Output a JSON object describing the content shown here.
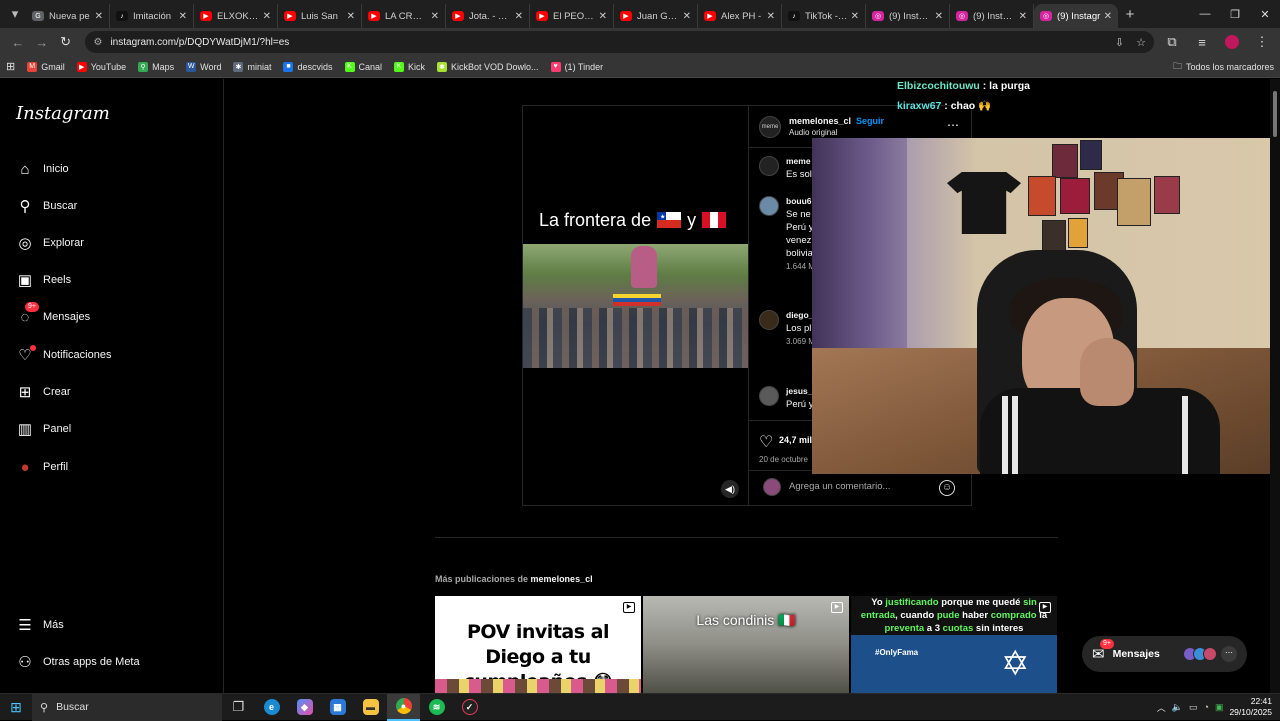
{
  "browser": {
    "tabs": [
      {
        "label": "Nueva pe",
        "fav_color": "#5f6368",
        "fav_glyph": "G"
      },
      {
        "label": "Imitación",
        "fav_color": "#111111",
        "fav_glyph": "♪"
      },
      {
        "label": "ELXOKAS",
        "fav_color": "#ff0000",
        "fav_glyph": "▶"
      },
      {
        "label": "Luis San",
        "fav_color": "#ff0000",
        "fav_glyph": "▶"
      },
      {
        "label": "LA CRONO",
        "fav_color": "#ff0000",
        "fav_glyph": "▶"
      },
      {
        "label": "Jota. - You",
        "fav_color": "#ff0000",
        "fav_glyph": "▶"
      },
      {
        "label": "El PEOR C",
        "fav_color": "#ff0000",
        "fav_glyph": "▶"
      },
      {
        "label": "Juan Gabri",
        "fav_color": "#ff0000",
        "fav_glyph": "▶"
      },
      {
        "label": "Alex PH -",
        "fav_color": "#ff0000",
        "fav_glyph": "▶"
      },
      {
        "label": "TikTok - M",
        "fav_color": "#111111",
        "fav_glyph": "♪"
      },
      {
        "label": "(9) Instagr",
        "fav_color": "#d6249f",
        "fav_glyph": "◎"
      },
      {
        "label": "(9) Instagr",
        "fav_color": "#d6249f",
        "fav_glyph": "◎"
      },
      {
        "label": "(9) Instagr",
        "fav_color": "#d6249f",
        "fav_glyph": "◎",
        "active": true
      }
    ],
    "url": "instagram.com/p/DQDYWatDjM1/?hl=es",
    "bookmarks": [
      {
        "label": "Gmail",
        "color": "#ea4335",
        "glyph": "M"
      },
      {
        "label": "YouTube",
        "color": "#ff0000",
        "glyph": "▶"
      },
      {
        "label": "Maps",
        "color": "#34a853",
        "glyph": "⚲"
      },
      {
        "label": "Word",
        "color": "#2b579a",
        "glyph": "W"
      },
      {
        "label": "miniat",
        "color": "#5f6b7a",
        "glyph": "✱"
      },
      {
        "label": "descvids",
        "color": "#1a73e8",
        "glyph": "■"
      },
      {
        "label": "Canal",
        "color": "#53fc18",
        "glyph": "K"
      },
      {
        "label": "Kick",
        "color": "#53fc18",
        "glyph": "K"
      },
      {
        "label": "KickBot VOD Dowlo...",
        "color": "#a6e22e",
        "glyph": "✱"
      },
      {
        "label": "(1) Tinder",
        "color": "#fe3c72",
        "glyph": "♥"
      }
    ],
    "all_bookmarks": "Todos los marcadores"
  },
  "sidebar": {
    "logo": "Instagram",
    "items": [
      {
        "label": "Inicio",
        "icon": "home-icon",
        "glyph": "⌂"
      },
      {
        "label": "Buscar",
        "icon": "search-icon",
        "glyph": "⚲"
      },
      {
        "label": "Explorar",
        "icon": "compass-icon",
        "glyph": "◎"
      },
      {
        "label": "Reels",
        "icon": "reels-icon",
        "glyph": "▣"
      },
      {
        "label": "Mensajes",
        "icon": "messenger-icon",
        "glyph": "◌",
        "badge": "9+"
      },
      {
        "label": "Notificaciones",
        "icon": "heart-icon",
        "glyph": "♡",
        "dot": true
      },
      {
        "label": "Crear",
        "icon": "plus-square-icon",
        "glyph": "⊞"
      },
      {
        "label": "Panel",
        "icon": "dashboard-icon",
        "glyph": "▥"
      },
      {
        "label": "Perfil",
        "icon": "profile-avatar-icon",
        "glyph": "●"
      }
    ],
    "bottom_items": [
      {
        "label": "Más",
        "icon": "hamburger-menu-icon",
        "glyph": "☰"
      },
      {
        "label": "Otras apps de Meta",
        "icon": "meta-apps-icon",
        "glyph": "⚇"
      }
    ]
  },
  "post": {
    "video_caption_text": "La frontera de",
    "video_caption_and": "y",
    "username": "memelones_cl",
    "follow": "Seguir",
    "audio": "Audio original",
    "comments": [
      {
        "user": "meme",
        "text": "Es solo",
        "meta": ""
      },
      {
        "user": "bouu6",
        "text": "Se ne\nPerú y\nvenez\nbolivia",
        "meta": "1.644 M"
      },
      {
        "user": "diego_",
        "text": "Los pl",
        "meta": "3.069 M"
      },
      {
        "user": "jesus_",
        "text": "Perú y",
        "meta": ""
      }
    ],
    "likes": "24,7 mil",
    "date": "20 de octubre",
    "comment_placeholder": "Agrega un comentario..."
  },
  "chat": [
    {
      "user": "Elbizcochitouwu",
      "message": ": la purga"
    },
    {
      "user": "kiraxw67",
      "message": ": chao 🙌"
    }
  ],
  "more_posts": {
    "label_prefix": "Más publicaciones de",
    "label_user": "memelones_cl",
    "thumb1_text": "POV invitas al Diego a tu cumpleaños 😳",
    "thumb2_text": "Las condinis 🇮🇹",
    "thumb3_parts": [
      "Yo ",
      "justificando",
      " porque me quedé ",
      "sin entrada",
      ", cuando ",
      "pude",
      " haber ",
      "comprado",
      " la ",
      "preventa",
      " a 3 ",
      "cuotas",
      " sin interes"
    ],
    "thumb3_tag": "#OnlyFama"
  },
  "messages_pill": {
    "label": "Mensajes",
    "badge": "9+"
  },
  "taskbar": {
    "search": "Buscar",
    "time": "22:41",
    "date": "29/10/2025"
  }
}
